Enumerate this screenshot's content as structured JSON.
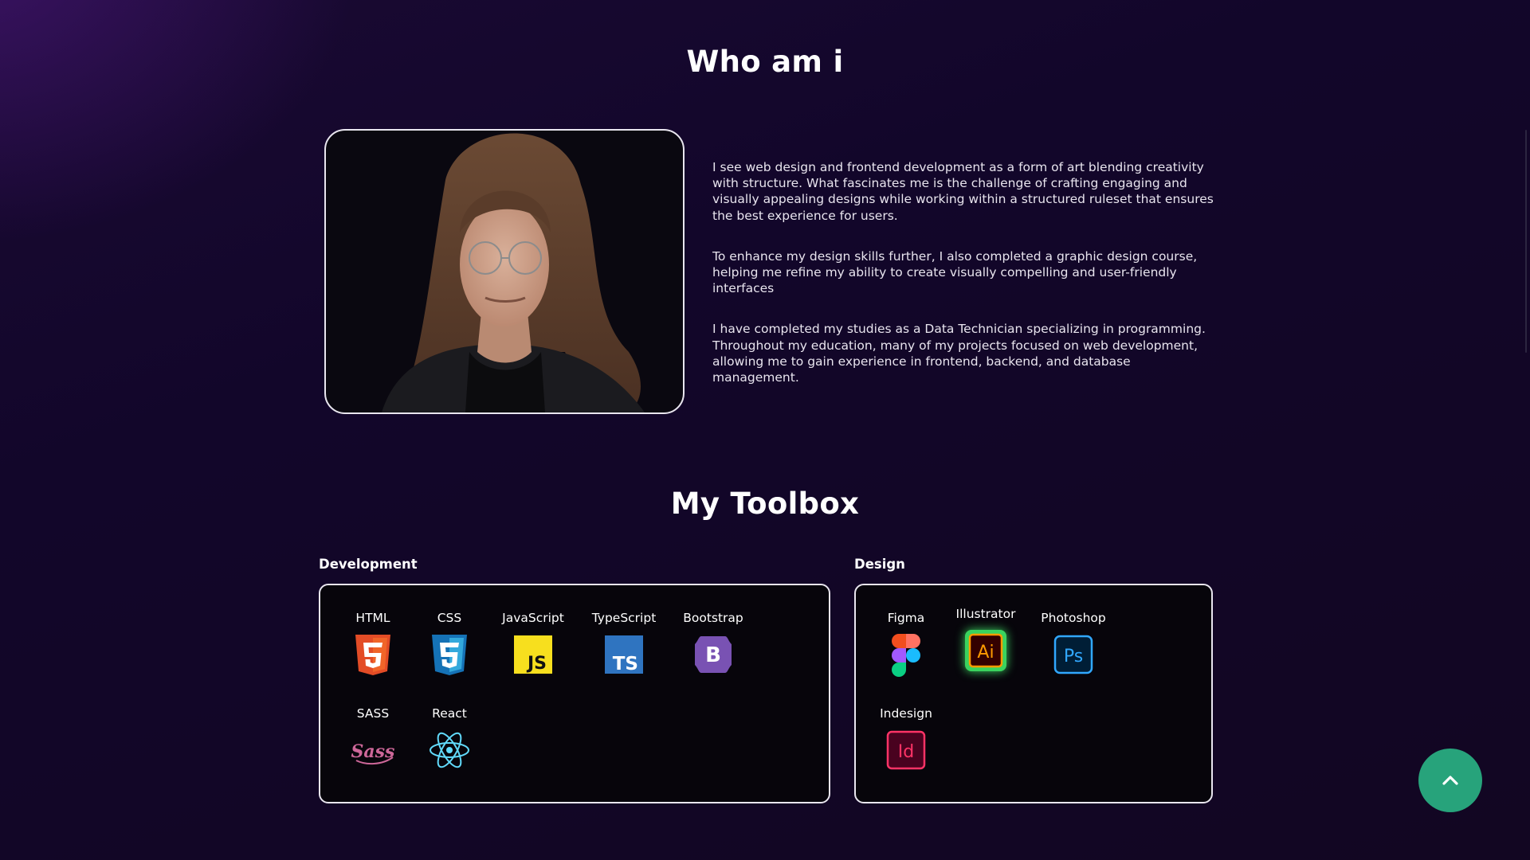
{
  "about": {
    "title": "Who am i",
    "paragraphs": [
      "I see web design and frontend development as a form of art blending creativity with structure. What fascinates me is the challenge of crafting engaging and visually appealing designs while working within a structured ruleset that ensures the best experience for users.",
      "To enhance my design skills further, I also completed a graphic design course, helping me refine my ability to create visually compelling and user-friendly interfaces",
      "I have completed my studies as a Data Technician specializing in programming. Throughout my education, many of my projects focused on web development, allowing me to gain experience in frontend, backend, and database management."
    ]
  },
  "toolbox": {
    "title": "My Toolbox",
    "development": {
      "label": "Development",
      "tools": [
        {
          "name": "HTML",
          "icon": "html5-icon"
        },
        {
          "name": "CSS",
          "icon": "css3-icon"
        },
        {
          "name": "JavaScript",
          "icon": "javascript-icon",
          "icon_text": "JS"
        },
        {
          "name": "TypeScript",
          "icon": "typescript-icon",
          "icon_text": "TS"
        },
        {
          "name": "Bootstrap",
          "icon": "bootstrap-icon",
          "icon_text": "B"
        },
        {
          "name": "SASS",
          "icon": "sass-icon",
          "icon_text": "Sass"
        },
        {
          "name": "React",
          "icon": "react-icon"
        }
      ]
    },
    "design": {
      "label": "Design",
      "tools": [
        {
          "name": "Figma",
          "icon": "figma-icon"
        },
        {
          "name": "Illustrator",
          "icon": "illustrator-icon",
          "icon_text": "Ai",
          "highlighted": true
        },
        {
          "name": "Photoshop",
          "icon": "photoshop-icon",
          "icon_text": "Ps"
        },
        {
          "name": "Indesign",
          "icon": "indesign-icon",
          "icon_text": "Id"
        }
      ]
    }
  },
  "scroll_to_top": {
    "icon": "chevron-up-icon"
  },
  "colors": {
    "background": "#14072a",
    "accent_green": "#27a37b",
    "card_border": "#e9e6ef"
  }
}
